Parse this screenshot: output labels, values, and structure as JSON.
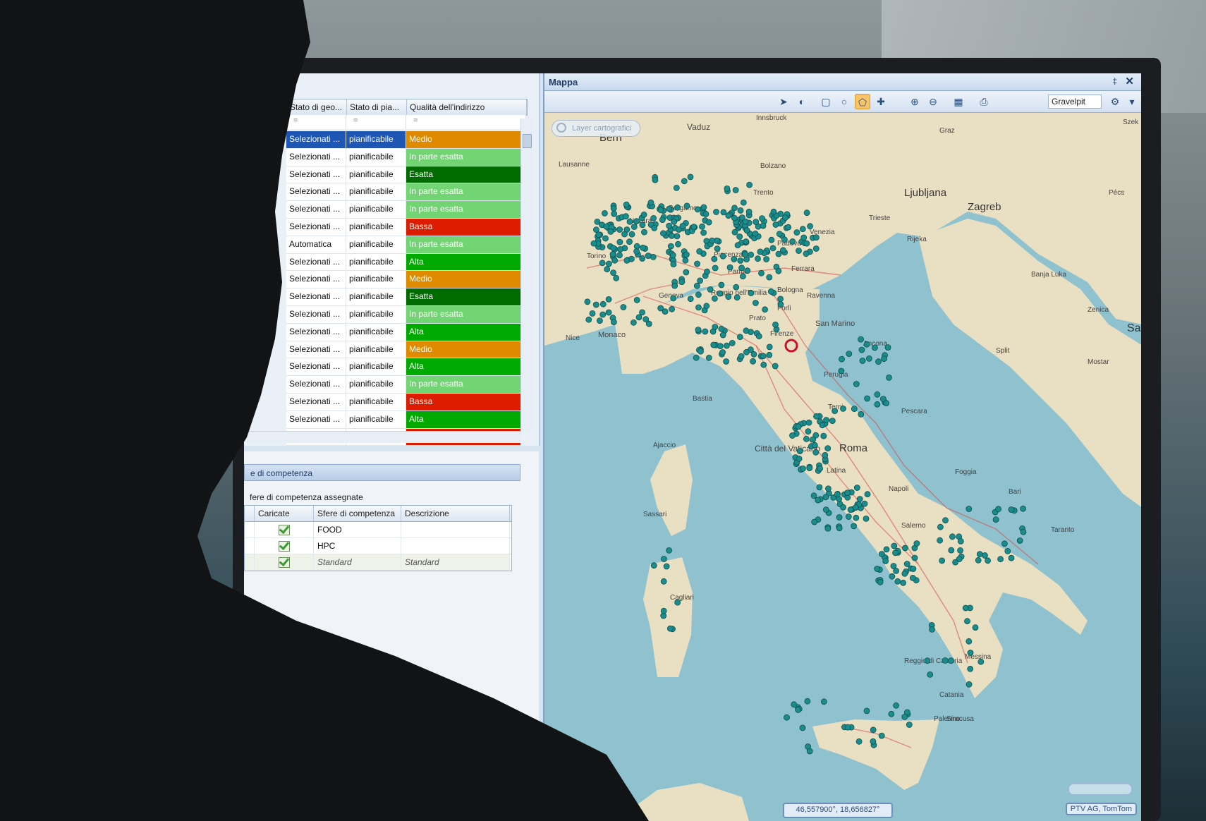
{
  "grid": {
    "columns": [
      "Stato di geo...",
      "Stato di pia...",
      "Qualità dell'indirizzo"
    ],
    "filter_symbol": "=",
    "rows": [
      {
        "geo": "Selezionati ...",
        "plan": "pianificabile",
        "quality": "Medio",
        "color": "#e08a00",
        "selected": true
      },
      {
        "geo": "Selezionati ...",
        "plan": "pianificabile",
        "quality": "In parte esatta",
        "color": "#72d472"
      },
      {
        "geo": "Selezionati ...",
        "plan": "pianificabile",
        "quality": "Esatta",
        "color": "#006b00"
      },
      {
        "geo": "Selezionati ...",
        "plan": "pianificabile",
        "quality": "In parte esatta",
        "color": "#72d472"
      },
      {
        "geo": "Selezionati ...",
        "plan": "pianificabile",
        "quality": "In parte esatta",
        "color": "#72d472"
      },
      {
        "geo": "Selezionati ...",
        "plan": "pianificabile",
        "quality": "Bassa",
        "color": "#dd1c00"
      },
      {
        "geo": "Automatica",
        "plan": "pianificabile",
        "quality": "In parte esatta",
        "color": "#72d472"
      },
      {
        "geo": "Selezionati ...",
        "plan": "pianificabile",
        "quality": "Alta",
        "color": "#00aa00"
      },
      {
        "geo": "Selezionati ...",
        "plan": "pianificabile",
        "quality": "Medio",
        "color": "#e08a00"
      },
      {
        "geo": "Selezionati ...",
        "plan": "pianificabile",
        "quality": "Esatta",
        "color": "#006b00"
      },
      {
        "geo": "Selezionati ...",
        "plan": "pianificabile",
        "quality": "In parte esatta",
        "color": "#72d472"
      },
      {
        "geo": "Selezionati ...",
        "plan": "pianificabile",
        "quality": "Alta",
        "color": "#00aa00"
      },
      {
        "geo": "Selezionati ...",
        "plan": "pianificabile",
        "quality": "Medio",
        "color": "#e08a00"
      },
      {
        "geo": "Selezionati ...",
        "plan": "pianificabile",
        "quality": "Alta",
        "color": "#00aa00"
      },
      {
        "geo": "Selezionati ...",
        "plan": "pianificabile",
        "quality": "In parte esatta",
        "color": "#72d472"
      },
      {
        "geo": "Selezionati ...",
        "plan": "pianificabile",
        "quality": "Bassa",
        "color": "#dd1c00"
      },
      {
        "geo": "Selezionati ...",
        "plan": "pianificabile",
        "quality": "Alta",
        "color": "#00aa00"
      },
      {
        "geo": "Selezionati ...",
        "plan": "pianificabile",
        "quality": "Bassa",
        "color": "#dd1c00"
      }
    ]
  },
  "competence": {
    "title": "e di competenza",
    "subtitle": "fere di competenza assegnate",
    "columns": [
      "Caricate",
      "Sfere di competenza",
      "Descrizione"
    ],
    "rows": [
      {
        "name": "FOOD",
        "desc": "",
        "checked": true
      },
      {
        "name": "HPC",
        "desc": "",
        "checked": true
      },
      {
        "name": "Standard",
        "desc": "Standard",
        "checked": true,
        "italic": true
      }
    ]
  },
  "map": {
    "title": "Mappa",
    "pin_glyph": "‡",
    "close_glyph": "✕",
    "profile_select": "Gravelpit",
    "layer_button": "Layer cartografici",
    "coordinates": "46,557900°, 18,656827°",
    "copyright": "PTV AG, TomTom",
    "labels": [
      "Bern",
      "Vaduz",
      "Innsbruck",
      "Lausanne",
      "Bolzano",
      "Trento",
      "Graz",
      "Ljubljana",
      "Zagreb",
      "Pécs",
      "Szek",
      "Trieste",
      "Rijeka",
      "Bergamo",
      "Novara",
      "Venezia",
      "Padova",
      "Piacenza",
      "Torino",
      "Ferrara",
      "Parma",
      "Reggio nell'Emilia",
      "Bologna",
      "Ravenna",
      "Genova",
      "Forlì",
      "Banja Luka",
      "Zenica",
      "Sa",
      "Nice",
      "Monaco",
      "Prato",
      "Firenze",
      "San Marino",
      "Ancona",
      "Split",
      "Mostar",
      "Perugia",
      "Bastia",
      "Terni",
      "Pescara",
      "Ajaccio",
      "Città del Vaticano",
      "Roma",
      "Latina",
      "Foggia",
      "Bari",
      "Sassari",
      "Napoli",
      "Salerno",
      "Taranto",
      "Cagliari",
      "Palermo",
      "Messina",
      "Reggio di Calabria",
      "Catania",
      "Siracusa"
    ],
    "colors": {
      "sea": "#8fc1cf",
      "land": "#e9dfc3",
      "marker": "#1a8c8c",
      "road": "#d6524a"
    }
  }
}
